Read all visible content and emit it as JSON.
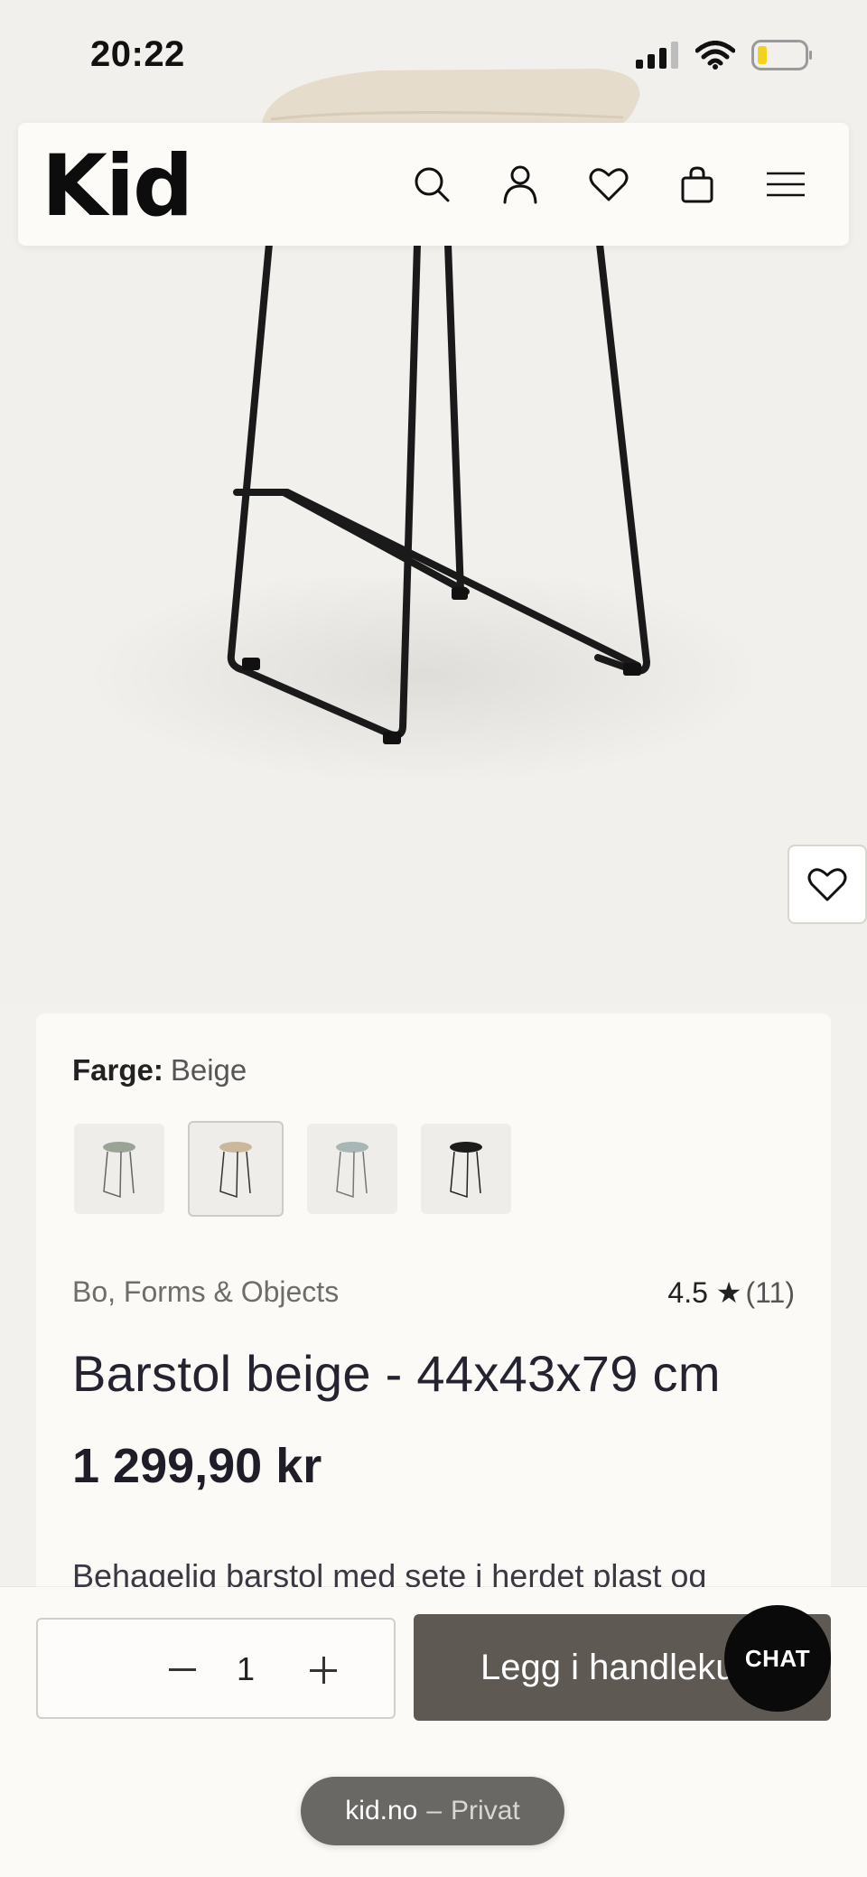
{
  "status_bar": {
    "time": "20:22"
  },
  "header": {
    "logo": "Kid",
    "icons": [
      "search-icon",
      "account-icon",
      "wishlist-icon",
      "bag-icon",
      "menu-icon"
    ]
  },
  "product": {
    "color_label": "Farge:",
    "color_value": "Beige",
    "swatches": [
      "Grønn",
      "Beige",
      "Blå",
      "Svart"
    ],
    "selected_swatch": 1,
    "brand": "Bo, Forms & Objects",
    "rating": "4.5 ★",
    "review_count": "(11)",
    "title": "Barstol beige - 44x43x79 cm",
    "price": "1 299,90 kr",
    "description": "Behagelig barstol med sete i herdet plast og"
  },
  "cart_bar": {
    "quantity": "1",
    "add_to_cart_label": "Legg i handlekurv",
    "chat_label": "CHAT"
  },
  "browser": {
    "domain": "kid.no",
    "separator": "–",
    "mode": "Privat"
  },
  "colors": {
    "background": "#f3f1ed",
    "card": "#fbfaf7",
    "add_to_cart_bg": "#5f5953",
    "chat_bg": "#0a0a0a",
    "seat_beige": "#e6dccb"
  }
}
